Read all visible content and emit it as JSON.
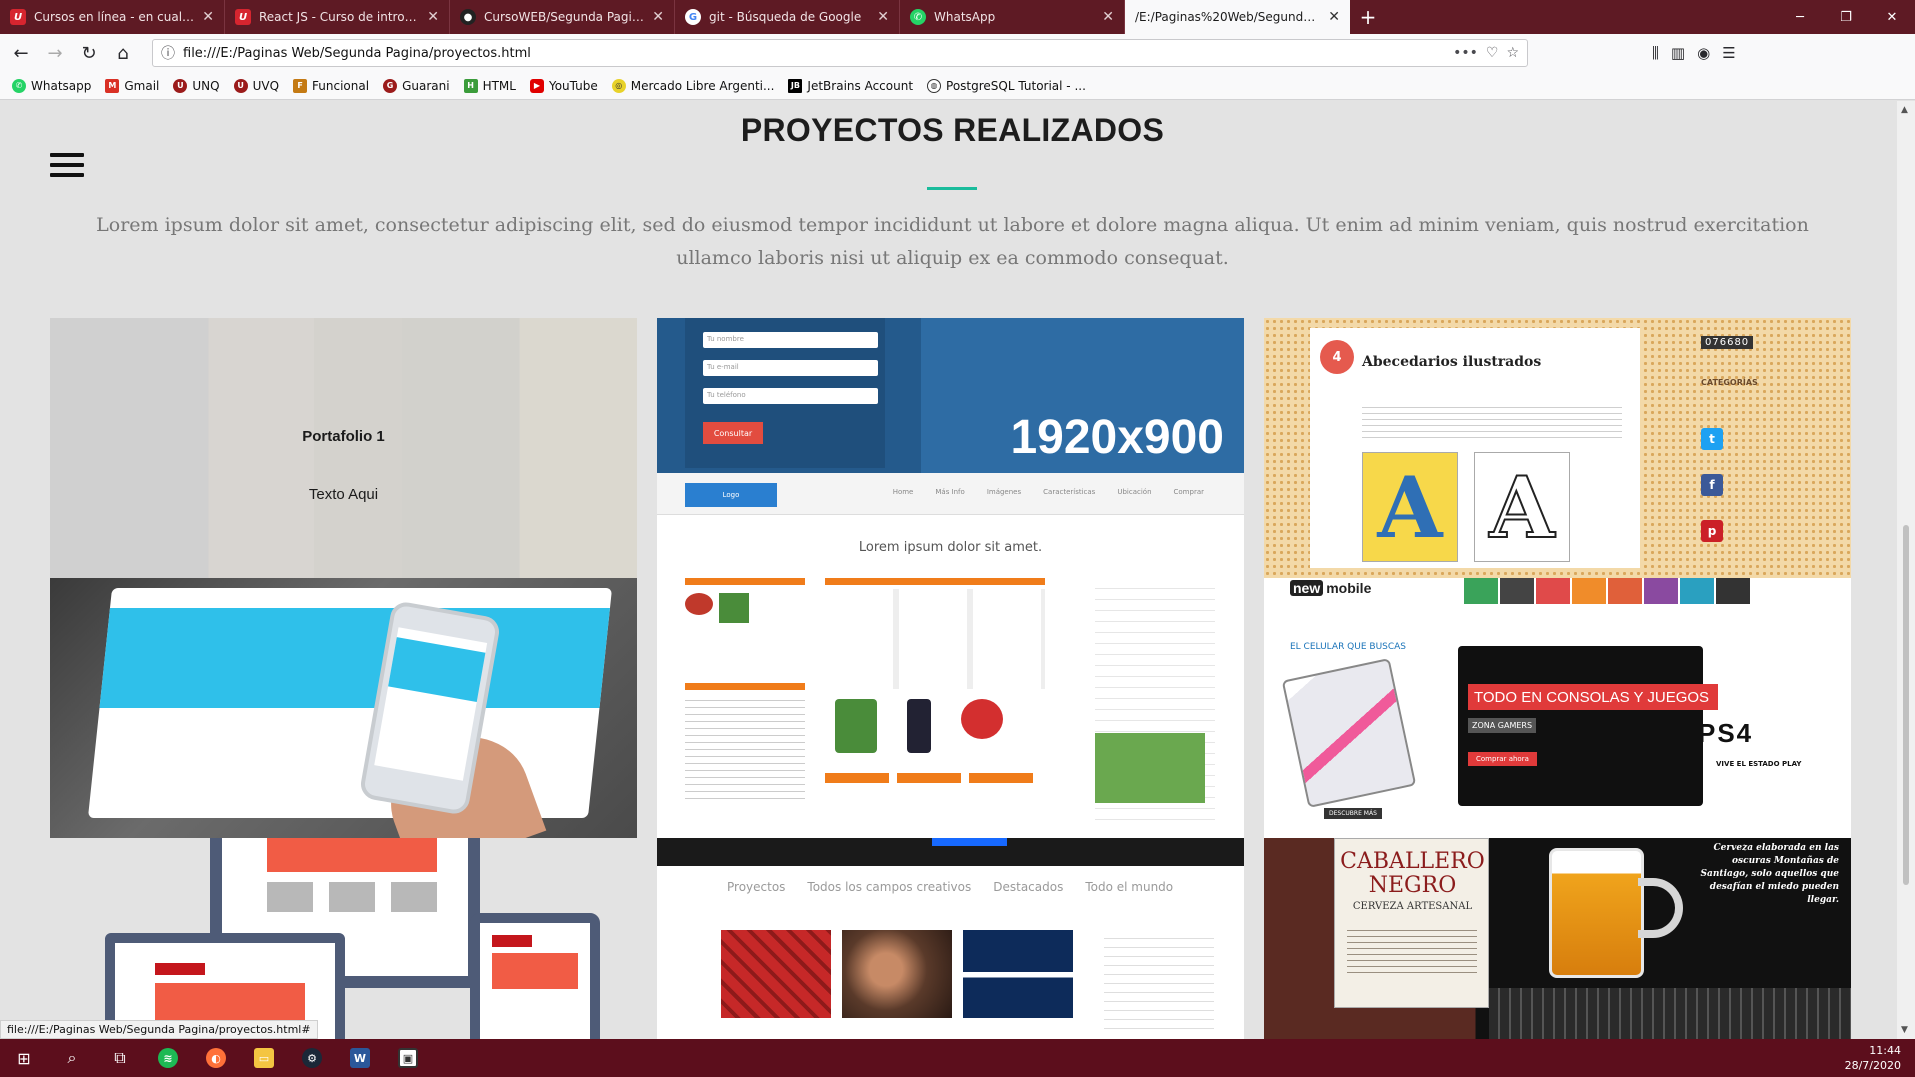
{
  "browser": {
    "tabs": [
      {
        "title": "Cursos en línea - en cualquier",
        "favicon": "udemy-icon",
        "active": false
      },
      {
        "title": "React JS - Curso de introducció",
        "favicon": "udemy-icon",
        "active": false
      },
      {
        "title": "CursoWEB/Segunda Pagina at",
        "favicon": "github-icon",
        "active": false
      },
      {
        "title": "git - Búsqueda de Google",
        "favicon": "google-icon",
        "active": false
      },
      {
        "title": "WhatsApp",
        "favicon": "whatsapp-icon",
        "active": false
      },
      {
        "title": "/E:/Paginas%20Web/Segunda%20P",
        "favicon": "none",
        "active": true
      }
    ],
    "url": "file:///E:/Paginas Web/Segunda Pagina/proyectos.html",
    "bookmarks": [
      {
        "label": "Whatsapp",
        "color": "#25d366"
      },
      {
        "label": "Gmail",
        "color": "#d93025"
      },
      {
        "label": "UNQ",
        "color": "#9b1b1b"
      },
      {
        "label": "UVQ",
        "color": "#9b1b1b"
      },
      {
        "label": "Funcional",
        "color": "#c47a14"
      },
      {
        "label": "Guarani",
        "color": "#9b1b1b"
      },
      {
        "label": "HTML",
        "color": "#3b9c3b"
      },
      {
        "label": "YouTube",
        "color": "#e00000"
      },
      {
        "label": "Mercado Libre Argenti...",
        "color": "#e8d22a"
      },
      {
        "label": "JetBrains Account",
        "color": "#000000"
      },
      {
        "label": "PostgreSQL Tutorial - ...",
        "color": "#333333"
      }
    ],
    "status_url": "file:///E:/Paginas Web/Segunda Pagina/proyectos.html#"
  },
  "page": {
    "title": "PROYECTOS REALIZADOS",
    "intro": "Lorem ipsum dolor sit amet, consectetur adipiscing elit, sed do eiusmod tempor incididunt ut labore et dolore magna aliqua. Ut enim ad minim veniam, quis nostrud exercitation ullamco laboris nisi ut aliquip ex ea commodo consequat.",
    "accent_color": "#1abc9c",
    "portfolio": {
      "overlay_title": "Portafolio 1",
      "overlay_text": "Texto Aqui",
      "tile2": {
        "form_fields": [
          "Tu nombre",
          "Tu e-mail",
          "Tu teléfono"
        ],
        "send_label": "Consultar",
        "resolution": "1920x900",
        "logo_label": "Logo",
        "menu": [
          "Home",
          "Más Info",
          "Imágenes",
          "Características",
          "Ubicación",
          "Comprar"
        ],
        "lorem": "Lorem ipsum dolor sit amet."
      },
      "tile3": {
        "counter": "076680",
        "number": "4",
        "heading": "Abecedarios ilustrados",
        "category_label": "CATEGORÍAS"
      },
      "tile5": {
        "brand_tag": "new",
        "brand": "mobile",
        "cel_label": "EL CELULAR QUE BUSCAS",
        "banner": "TODO EN CONSOLAS Y JUEGOS",
        "zone": "ZONA GAMERS",
        "buy": "Comprar ahora",
        "ps4": "PS4",
        "ps4_sub": "VIVE EL ESTADO PLAY",
        "desc_btn": "DESCUBRE MÁS"
      },
      "tile7": {
        "filters": [
          "Proyectos",
          "Todos los campos creativos",
          "Destacados",
          "Todo el mundo"
        ]
      },
      "tile8": {
        "name_line1": "CABALLERO",
        "name_line2": "NEGRO",
        "subtitle": "CERVEZA ARTESANAL",
        "tagline": "Cerveza elaborada en las oscuras Montañas de Santiago, solo aquellos que desafían el miedo pueden llegar."
      }
    }
  },
  "taskbar": {
    "time": "11:44",
    "date": "28/7/2020"
  }
}
